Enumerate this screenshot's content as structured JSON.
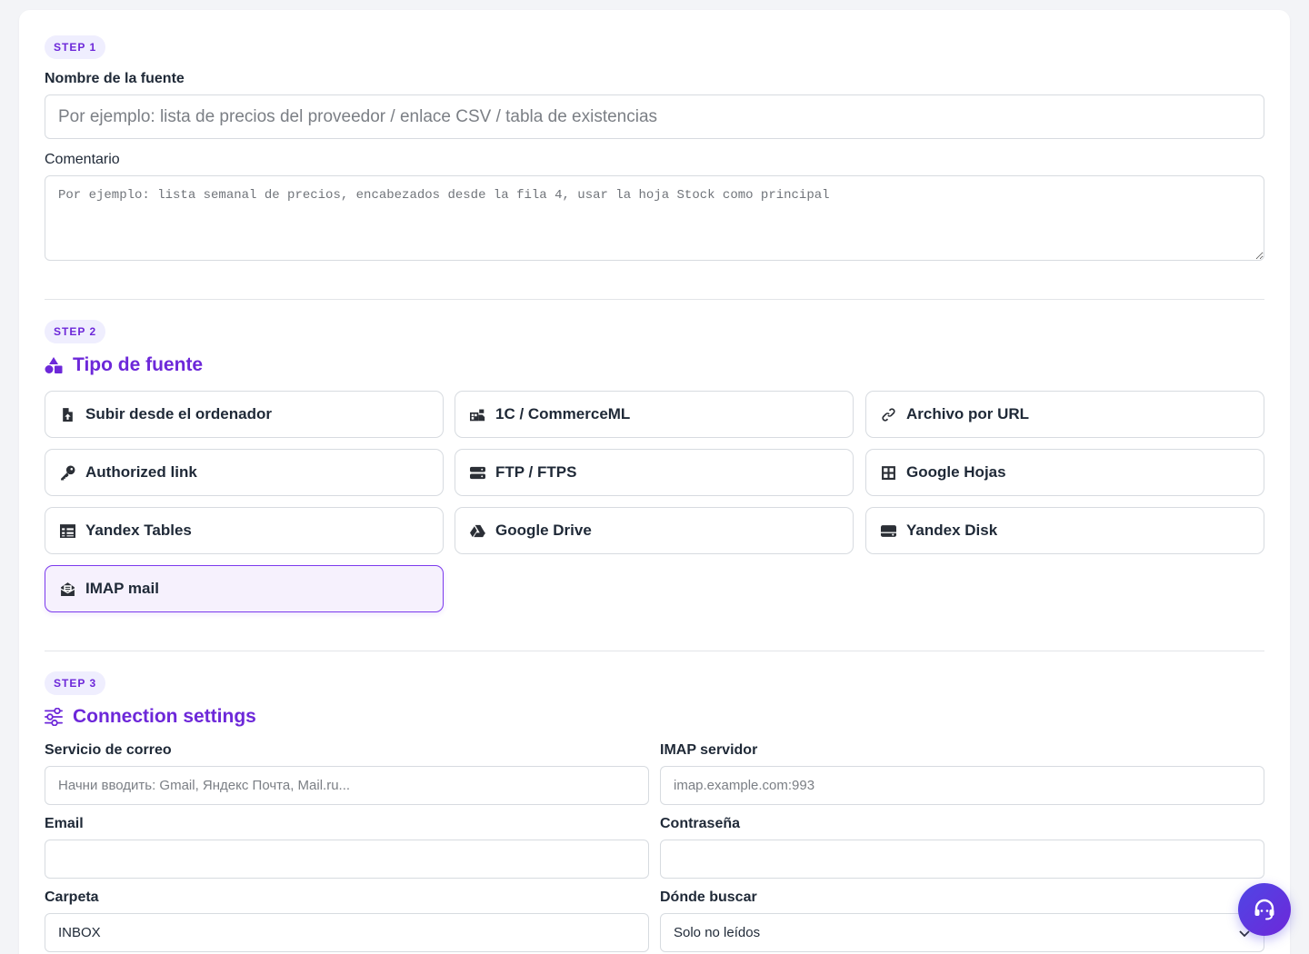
{
  "step1": {
    "badge": "STEP 1",
    "name_label": "Nombre de la fuente",
    "name_placeholder": "Por ejemplo: lista de precios del proveedor / enlace CSV / tabla de existencias",
    "comment_label": "Comentario",
    "comment_placeholder": "Por ejemplo: lista semanal de precios, encabezados desde la fila 4, usar la hoja Stock como principal"
  },
  "step2": {
    "badge": "STEP 2",
    "title": "Tipo de fuente",
    "options": [
      {
        "label": "Subir desde el ordenador",
        "icon": "file-upload-icon"
      },
      {
        "label": "1C / CommerceML",
        "icon": "warehouse-icon"
      },
      {
        "label": "Archivo por URL",
        "icon": "link-icon"
      },
      {
        "label": "Authorized link",
        "icon": "key-icon"
      },
      {
        "label": "FTP / FTPS",
        "icon": "server-icon"
      },
      {
        "label": "Google Hojas",
        "icon": "table-grid-icon"
      },
      {
        "label": "Yandex Tables",
        "icon": "table-list-icon"
      },
      {
        "label": "Google Drive",
        "icon": "google-drive-icon"
      },
      {
        "label": "Yandex Disk",
        "icon": "hard-drive-icon"
      },
      {
        "label": "IMAP mail",
        "icon": "mail-inbox-icon",
        "selected": true
      }
    ]
  },
  "step3": {
    "badge": "STEP 3",
    "title": "Connection settings",
    "mail_service_label": "Servicio de correo",
    "mail_service_placeholder": "Начни вводить: Gmail, Яндекс Почта, Mail.ru...",
    "imap_server_label": "IMAP servidor",
    "imap_server_placeholder": "imap.example.com:993",
    "email_label": "Email",
    "email_value": "",
    "password_label": "Contraseña",
    "password_value": "",
    "folder_label": "Carpeta",
    "folder_value": "INBOX",
    "search_label": "Dónde buscar",
    "search_value": "Solo no leídos"
  },
  "colors": {
    "accent": "#6d28d9",
    "badge_bg": "#efeefe",
    "selected_bg": "#f6f1fd",
    "border": "#d7dbe0"
  }
}
